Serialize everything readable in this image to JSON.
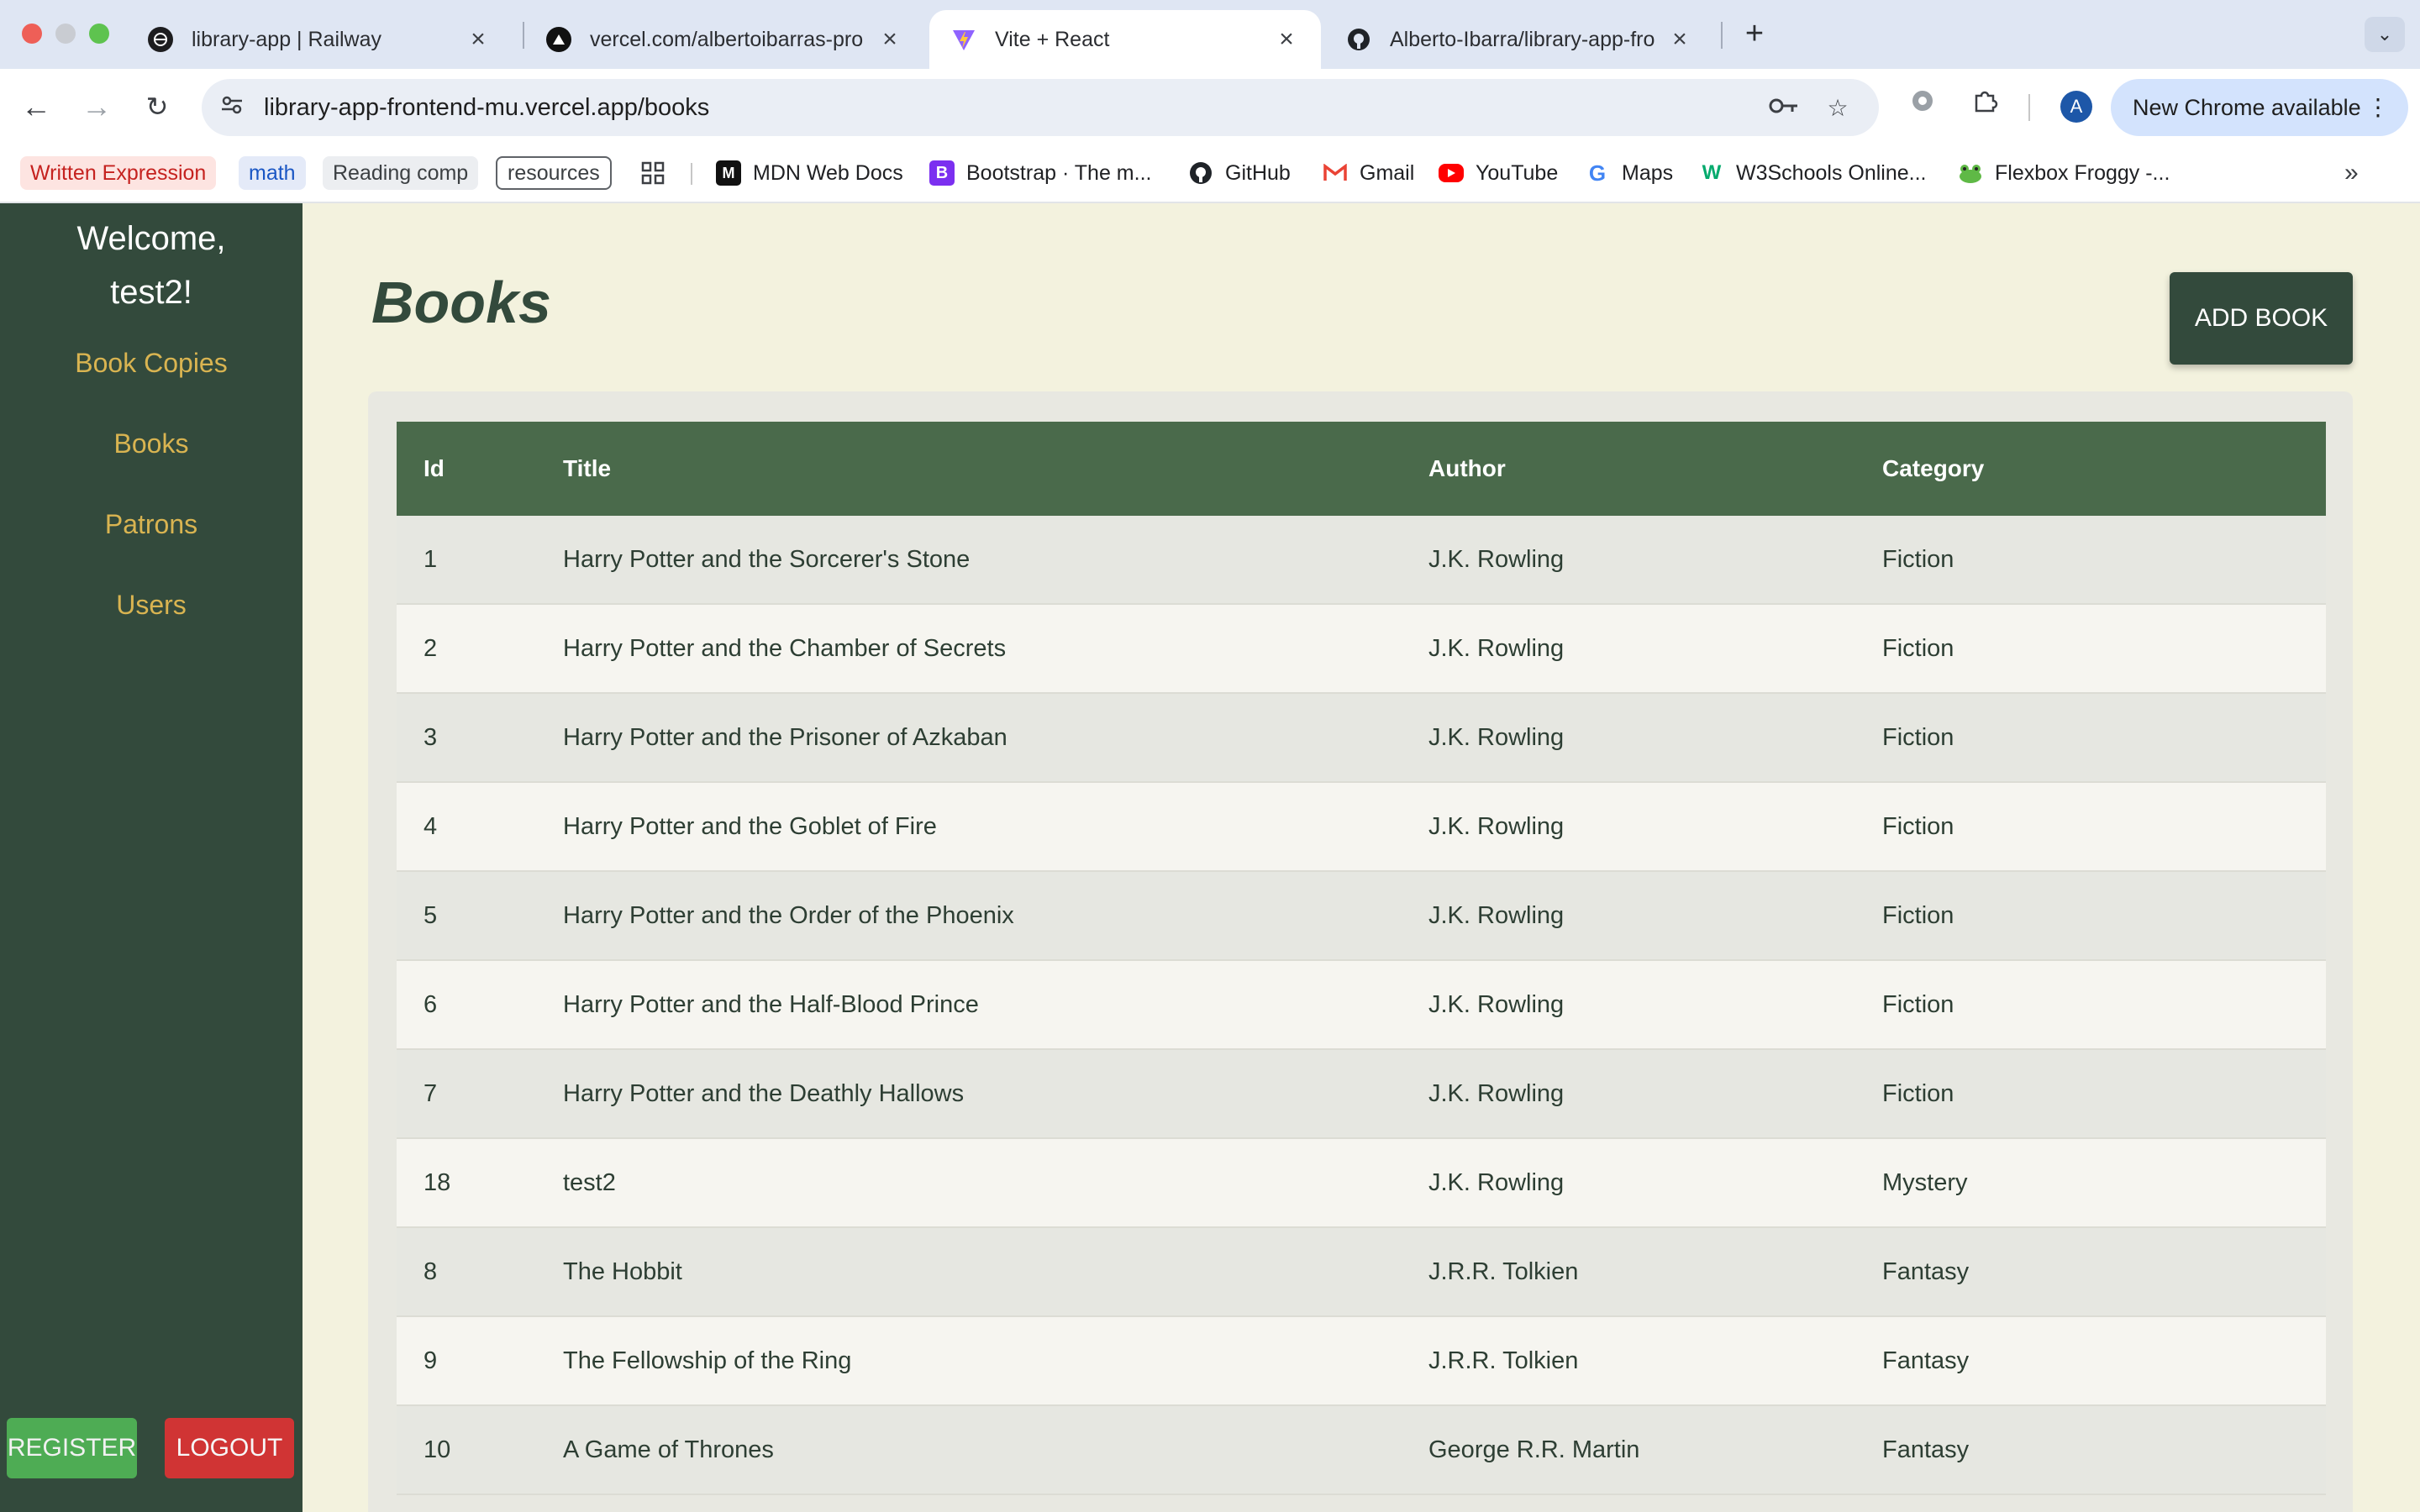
{
  "browser": {
    "tabs": [
      {
        "label": "library-app | Railway",
        "icon": "railway-icon"
      },
      {
        "label": "vercel.com/albertoibarras-pro",
        "icon": "vercel-icon"
      },
      {
        "label": "Vite + React",
        "icon": "vite-icon"
      },
      {
        "label": "Alberto-Ibarra/library-app-fro",
        "icon": "github-icon"
      }
    ],
    "new_tab": "+",
    "url": "library-app-frontend-mu.vercel.app/books",
    "profile_initial": "A",
    "new_chrome_label": "New Chrome available",
    "bookmarks": {
      "chips": [
        "Written Expression",
        "math",
        "Reading comp",
        "resources"
      ],
      "items": [
        "MDN Web Docs",
        "Bootstrap · The m...",
        "GitHub",
        "Gmail",
        "YouTube",
        "Maps",
        "W3Schools Online...",
        "Flexbox Froggy -..."
      ]
    }
  },
  "sidebar": {
    "welcome_line1": "Welcome,",
    "welcome_line2": "test2!",
    "links": [
      "Book Copies",
      "Books",
      "Patrons",
      "Users"
    ],
    "register_label": "REGISTER",
    "logout_label": "LOGOUT"
  },
  "main": {
    "title": "Books",
    "add_button": "ADD BOOK",
    "columns": [
      "Id",
      "Title",
      "Author",
      "Category"
    ],
    "rows": [
      {
        "id": "1",
        "title": "Harry Potter and the Sorcerer's Stone",
        "author": "J.K. Rowling",
        "category": "Fiction"
      },
      {
        "id": "2",
        "title": "Harry Potter and the Chamber of Secrets",
        "author": "J.K. Rowling",
        "category": "Fiction"
      },
      {
        "id": "3",
        "title": "Harry Potter and the Prisoner of Azkaban",
        "author": "J.K. Rowling",
        "category": "Fiction"
      },
      {
        "id": "4",
        "title": "Harry Potter and the Goblet of Fire",
        "author": "J.K. Rowling",
        "category": "Fiction"
      },
      {
        "id": "5",
        "title": "Harry Potter and the Order of the Phoenix",
        "author": "J.K. Rowling",
        "category": "Fiction"
      },
      {
        "id": "6",
        "title": "Harry Potter and the Half-Blood Prince",
        "author": "J.K. Rowling",
        "category": "Fiction"
      },
      {
        "id": "7",
        "title": "Harry Potter and the Deathly Hallows",
        "author": "J.K. Rowling",
        "category": "Fiction"
      },
      {
        "id": "18",
        "title": "test2",
        "author": "J.K. Rowling",
        "category": "Mystery"
      },
      {
        "id": "8",
        "title": "The Hobbit",
        "author": "J.R.R. Tolkien",
        "category": "Fantasy"
      },
      {
        "id": "9",
        "title": "The Fellowship of the Ring",
        "author": "J.R.R. Tolkien",
        "category": "Fantasy"
      },
      {
        "id": "10",
        "title": "A Game of Thrones",
        "author": "George R.R. Martin",
        "category": "Fantasy"
      }
    ]
  },
  "colors": {
    "sidebar_bg": "#334a3c",
    "accent_gold": "#d9b451",
    "table_header": "#4a6a4b",
    "page_bg": "#f3f2de",
    "register": "#4eac54",
    "logout": "#d03434"
  }
}
